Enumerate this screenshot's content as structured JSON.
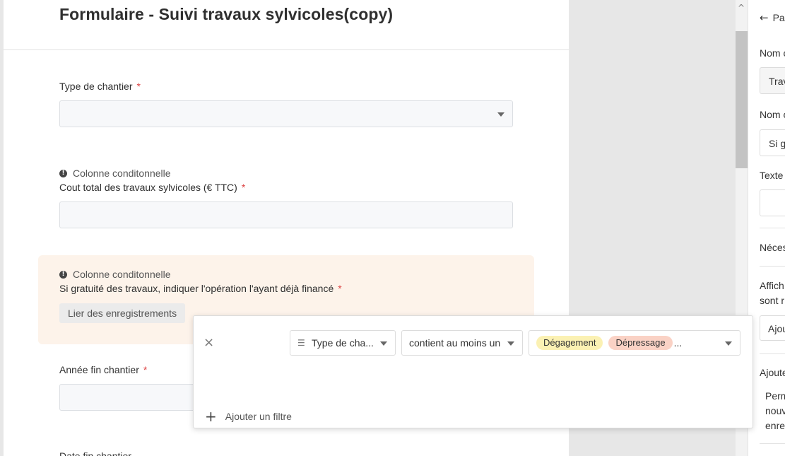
{
  "form": {
    "title": "Formulaire - Suivi travaux sylvicoles(copy)",
    "fields": [
      {
        "label": "Type de chantier",
        "required": "*"
      },
      {
        "note": "Colonne conditonnelle",
        "label": "Cout total des travaux sylvicoles (€ TTC)",
        "required": "*"
      },
      {
        "note": "Colonne conditonnelle",
        "label": "Si gratuité des travaux, indiquer l'opération l'ayant déjà financé",
        "required": "*",
        "button": "Lier des enregistrements"
      },
      {
        "label": "Année fin chantier",
        "required": "*"
      },
      {
        "label": "Date fin chantier"
      }
    ]
  },
  "filter": {
    "field": "Type de cha...",
    "operator": "contient au moins un",
    "values": [
      "Dégagement",
      "Dépressage"
    ],
    "ellipsis": "...",
    "add_label": "Ajouter un filtre",
    "tag_colors": [
      "#fbf1b3",
      "#fad2c5"
    ]
  },
  "right_panel": {
    "back": "Pa",
    "items": [
      "Nom c",
      "Trav",
      "Nom c",
      "Si g",
      "Texte",
      "Néces",
      "Affich",
      "sont r",
      "Ajou",
      "Ajoute",
      "Perm",
      "nouv",
      "enre"
    ]
  },
  "icons": {
    "back": "arrow-left-icon",
    "close": "close-icon",
    "list": "list-icon",
    "add": "plus-icon",
    "note": "exclamation-icon",
    "dropdown": "chevron-down-icon",
    "scroll": "scroll-up-icon"
  }
}
